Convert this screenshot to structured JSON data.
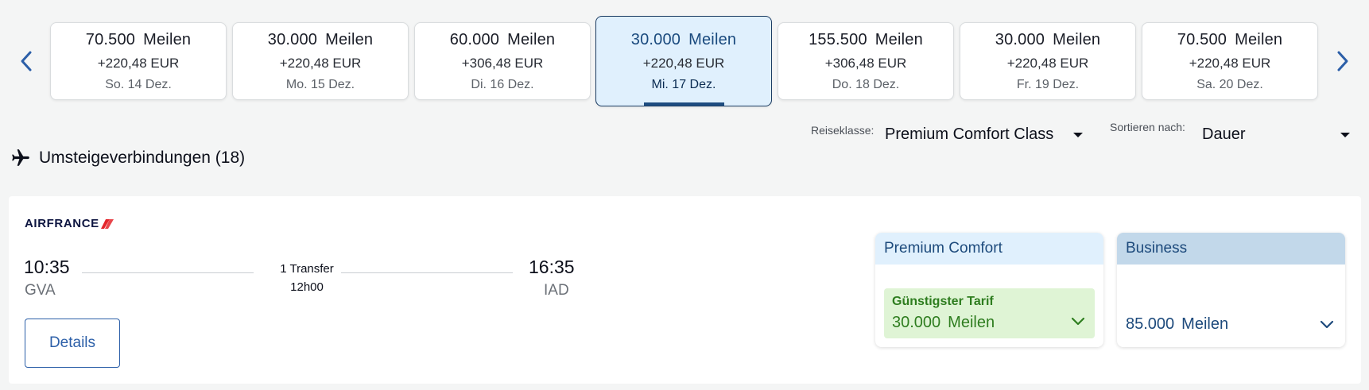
{
  "date_strip": [
    {
      "miles_value": "70.500",
      "miles_unit": "Meilen",
      "eur": "+220,48 EUR",
      "day": "So. 14 Dez.",
      "selected": false
    },
    {
      "miles_value": "30.000",
      "miles_unit": "Meilen",
      "eur": "+220,48 EUR",
      "day": "Mo. 15 Dez.",
      "selected": false
    },
    {
      "miles_value": "60.000",
      "miles_unit": "Meilen",
      "eur": "+306,48 EUR",
      "day": "Di. 16 Dez.",
      "selected": false
    },
    {
      "miles_value": "30.000",
      "miles_unit": "Meilen",
      "eur": "+220,48 EUR",
      "day": "Mi. 17 Dez.",
      "selected": true
    },
    {
      "miles_value": "155.500",
      "miles_unit": "Meilen",
      "eur": "+306,48 EUR",
      "day": "Do. 18 Dez.",
      "selected": false
    },
    {
      "miles_value": "30.000",
      "miles_unit": "Meilen",
      "eur": "+220,48 EUR",
      "day": "Fr. 19 Dez.",
      "selected": false
    },
    {
      "miles_value": "70.500",
      "miles_unit": "Meilen",
      "eur": "+220,48 EUR",
      "day": "Sa. 20 Dez.",
      "selected": false
    }
  ],
  "filters": {
    "class_label": "Reiseklasse:",
    "class_value": "Premium Comfort Class",
    "sort_label": "Sortieren nach:",
    "sort_value": "Dauer"
  },
  "section": {
    "title": "Umsteigeverbindungen (18)"
  },
  "flight": {
    "airline": "AIRFRANCE",
    "departure_time": "10:35",
    "departure_airport": "GVA",
    "arrival_time": "16:35",
    "arrival_airport": "IAD",
    "transfer": "1 Transfer",
    "duration": "12h00",
    "details_label": "Details",
    "fares": {
      "premium": {
        "title": "Premium Comfort",
        "tag": "Günstigster Tarif",
        "miles_value": "30.000",
        "miles_unit": "Meilen"
      },
      "business": {
        "title": "Business",
        "miles_value": "85.000",
        "miles_unit": "Meilen"
      }
    }
  },
  "colors": {
    "accent_blue": "#2c5fa8",
    "selected_bg": "#e0f0fd",
    "cheapest_green": "#2e7d1f",
    "cheapest_bg": "#dff4d5",
    "business_header": "#c2d8ea"
  },
  "icons": {
    "prev": "chevron-left-icon",
    "next": "chevron-right-icon",
    "plane": "airplane-icon",
    "expand": "chevron-down-icon"
  }
}
